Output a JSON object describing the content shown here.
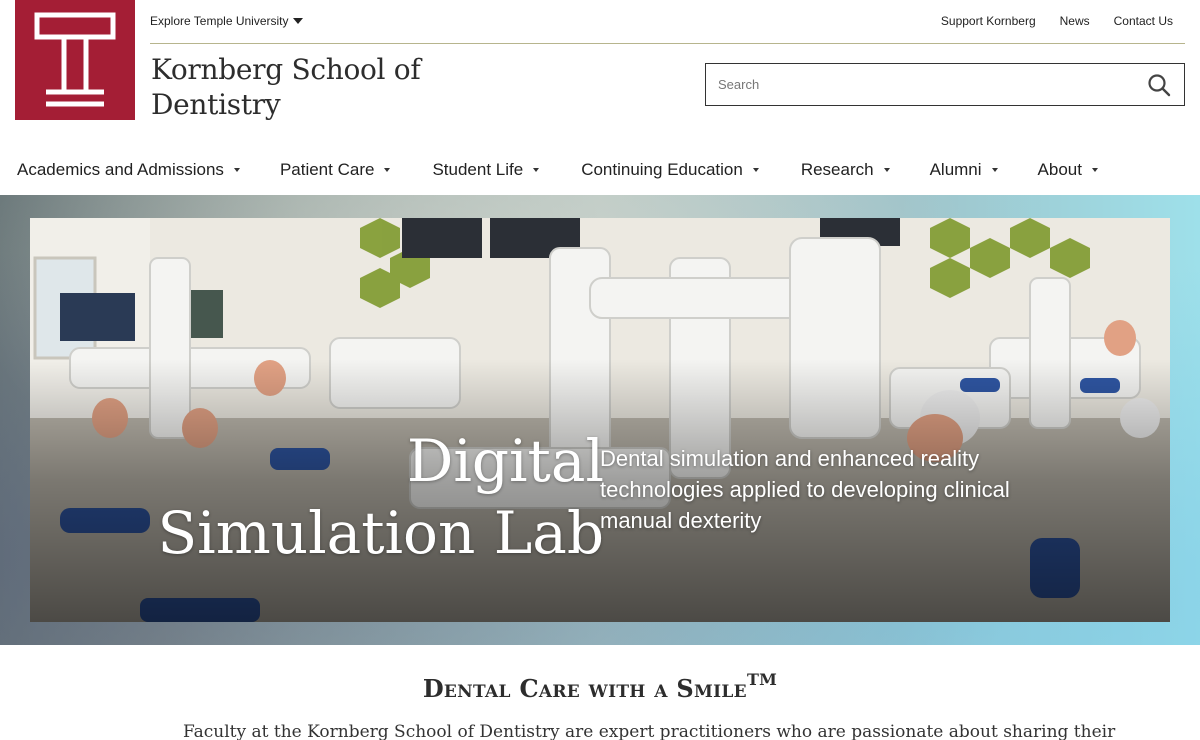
{
  "header": {
    "explore_label": "Explore Temple University",
    "utility_links": [
      "Support Kornberg",
      "News",
      "Contact Us"
    ],
    "school_name_line1": "Kornberg School of",
    "school_name_line2": "Dentistry",
    "brand_color": "#a41e35"
  },
  "search": {
    "placeholder": "Search",
    "icon": "search-icon"
  },
  "nav": {
    "items": [
      {
        "label": "Academics and Admissions"
      },
      {
        "label": "Patient Care"
      },
      {
        "label": "Student Life"
      },
      {
        "label": "Continuing Education"
      },
      {
        "label": "Research"
      },
      {
        "label": "Alumni"
      },
      {
        "label": "About"
      }
    ]
  },
  "hero": {
    "title_line1": "Digital",
    "title_line2": "Simulation Lab",
    "subtitle": "Dental simulation and enhanced reality technologies applied to developing clinical manual dexterity"
  },
  "content": {
    "tagline": "Dental Care with a Smile",
    "tagline_mark": "TM",
    "intro": "Faculty at the Kornberg School of Dentistry are expert practitioners who are passionate about sharing their"
  }
}
